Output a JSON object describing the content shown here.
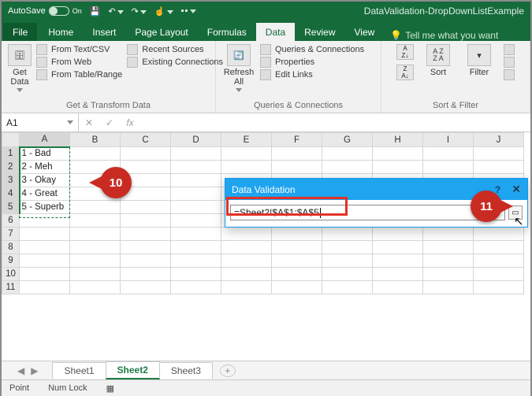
{
  "titlebar": {
    "autosave_label": "AutoSave",
    "autosave_state": "On",
    "doc_title": "DataValidation-DropDownListExample"
  },
  "qat_icons": [
    "save-icon",
    "undo-icon",
    "redo-icon",
    "touch-mode-icon",
    "account-icon"
  ],
  "tabs": {
    "file": "File",
    "items": [
      "Home",
      "Insert",
      "Page Layout",
      "Formulas",
      "Data",
      "Review",
      "View"
    ],
    "active": "Data",
    "tellme": "Tell me what you want"
  },
  "ribbon": {
    "group1": {
      "big": "Get\nData",
      "items": [
        "From Text/CSV",
        "From Web",
        "From Table/Range"
      ],
      "items2": [
        "Recent Sources",
        "Existing Connections"
      ],
      "label": "Get & Transform Data"
    },
    "group2": {
      "big": "Refresh\nAll",
      "items": [
        "Queries & Connections",
        "Properties",
        "Edit Links"
      ],
      "label": "Queries & Connections"
    },
    "group3": {
      "sort": "Sort",
      "filter": "Filter",
      "label": "Sort & Filter"
    }
  },
  "namebox": {
    "value": "A1"
  },
  "formula_bar": {
    "fx": "fx"
  },
  "columns": [
    "A",
    "B",
    "C",
    "D",
    "E",
    "F",
    "G",
    "H",
    "I",
    "J"
  ],
  "rows": [
    1,
    2,
    3,
    4,
    5,
    6,
    7,
    8,
    9,
    10,
    11
  ],
  "cellsA": [
    "1 - Bad",
    "2 - Meh",
    "3 - Okay",
    "4 - Great",
    "5 - Superb"
  ],
  "dialog": {
    "title": "Data Validation",
    "formula": "=Sheet2!$A$1:$A$5",
    "help": "?",
    "close": "✕"
  },
  "callouts": {
    "c10": "10",
    "c11": "11"
  },
  "sheets": {
    "items": [
      "Sheet1",
      "Sheet2",
      "Sheet3"
    ],
    "active": "Sheet2"
  },
  "statusbar": {
    "mode": "Point",
    "numlock": "Num Lock"
  }
}
